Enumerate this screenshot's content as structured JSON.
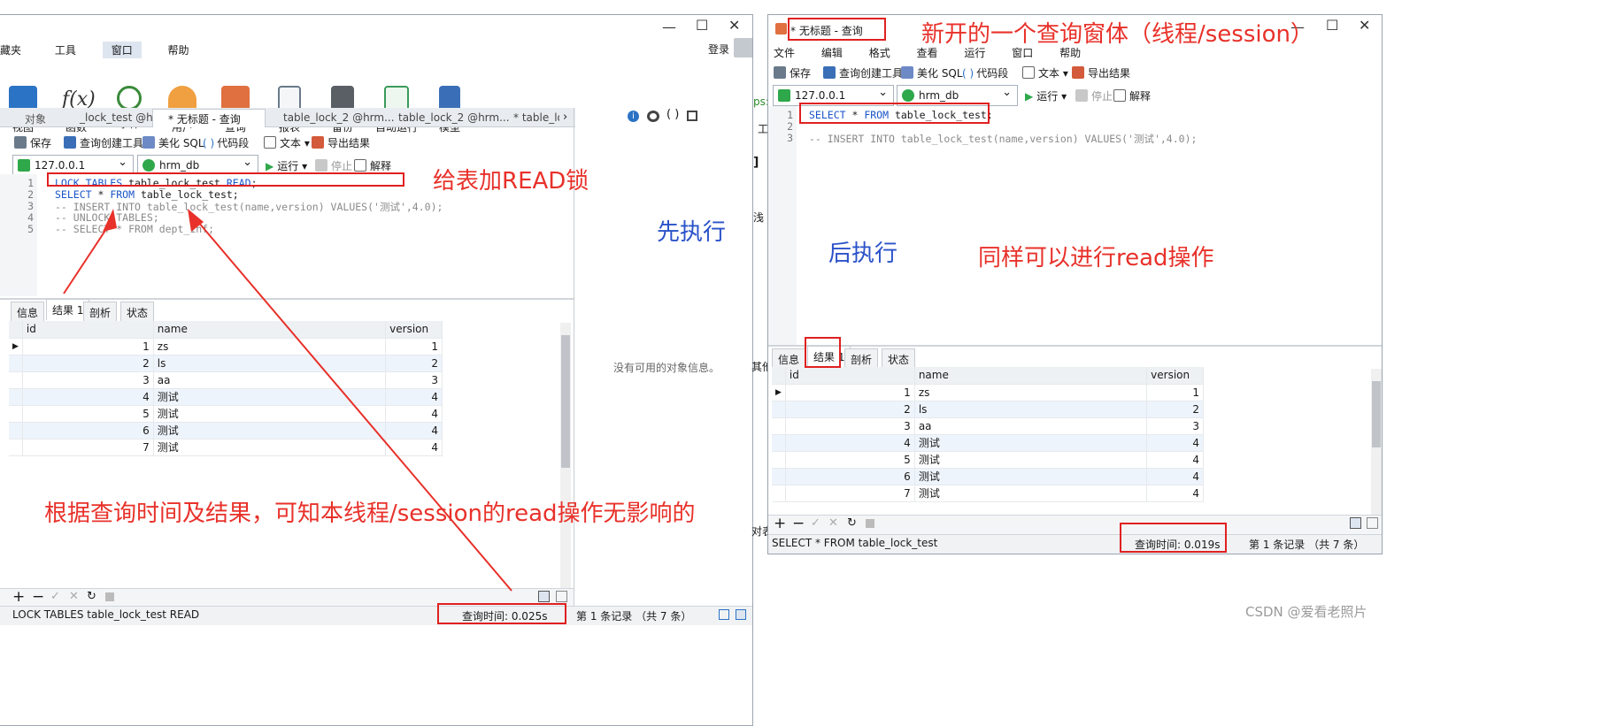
{
  "colors": {
    "annotation_red": "#e8312a",
    "annotation_blue": "#2a52c9",
    "keyword_blue": "#1a55c9"
  },
  "left_window": {
    "menu": [
      "藏夹",
      "工具",
      "窗口",
      "帮助"
    ],
    "login": "登录",
    "big_tools": [
      {
        "label": "视图",
        "icon": "view-icon"
      },
      {
        "label": "函数",
        "icon": "function-icon"
      },
      {
        "label": "事件",
        "icon": "event-clock-icon"
      },
      {
        "label": "用户",
        "icon": "user-icon"
      },
      {
        "label": "查询",
        "icon": "query-icon"
      },
      {
        "label": "报表",
        "icon": "report-icon"
      },
      {
        "label": "备份",
        "icon": "backup-icon"
      },
      {
        "label": "自动运行",
        "icon": "auto-run-icon"
      },
      {
        "label": "模型",
        "icon": "model-icon"
      }
    ],
    "doc_tabs": [
      "对象",
      "_lock_test @hr...",
      "* 无标题 - 查询",
      "table_lock_2 @hrm...",
      "table_lock_2 @hrm...",
      "* table_loc"
    ],
    "toolbar": {
      "save": "保存",
      "query_builder": "查询创建工具",
      "beautify": "美化 SQL",
      "snippet": "代码段",
      "text": "文本",
      "export": "导出结果"
    },
    "connection": "127.0.0.1",
    "database": "hrm_db",
    "run": "运行",
    "stop": "停止",
    "explain": "解释",
    "code_lines": [
      {
        "n": "1",
        "parts": [
          {
            "t": "LOCK TABLES",
            "c": "kw"
          },
          {
            "t": " table_lock_test ",
            "c": ""
          },
          {
            "t": "READ",
            "c": "kw"
          },
          {
            "t": ";",
            "c": ""
          }
        ]
      },
      {
        "n": "2",
        "parts": [
          {
            "t": "SELECT",
            "c": "kw"
          },
          {
            "t": " * ",
            "c": ""
          },
          {
            "t": "FROM",
            "c": "kw"
          },
          {
            "t": " table_lock_test;",
            "c": ""
          }
        ]
      },
      {
        "n": "3",
        "parts": [
          {
            "t": "-- INSERT INTO table_lock_test(name,version) VALUES('测试',4.0);",
            "c": "cm"
          }
        ]
      },
      {
        "n": "4",
        "parts": [
          {
            "t": "-- UNLOCK TABLES;",
            "c": "cm"
          }
        ]
      },
      {
        "n": "5",
        "parts": [
          {
            "t": "-- SELECT * FROM dept_inf;",
            "c": "cm"
          }
        ]
      }
    ],
    "result_tabs": [
      "信息",
      "结果 1",
      "剖析",
      "状态"
    ],
    "columns": [
      "id",
      "name",
      "version"
    ],
    "rows": [
      [
        "1",
        "zs",
        "1"
      ],
      [
        "2",
        "ls",
        "2"
      ],
      [
        "3",
        "aa",
        "3"
      ],
      [
        "4",
        "测试",
        "4"
      ],
      [
        "5",
        "测试",
        "4"
      ],
      [
        "6",
        "测试",
        "4"
      ],
      [
        "7",
        "测试",
        "4"
      ]
    ],
    "status_sql": "LOCK TABLES table_lock_test READ",
    "query_time": "查询时间: 0.025s",
    "record_info": "第 1 条记录 （共 7 条）",
    "no_object_info": "没有可用的对象信息。"
  },
  "right_window": {
    "title": "* 无标题 - 查询",
    "menu": [
      "文件",
      "编辑",
      "格式",
      "查看",
      "运行",
      "窗口",
      "帮助"
    ],
    "toolbar": {
      "save": "保存",
      "query_builder": "查询创建工具",
      "beautify": "美化 SQL",
      "snippet": "代码段",
      "text": "文本",
      "export": "导出结果"
    },
    "connection": "127.0.0.1",
    "database": "hrm_db",
    "run": "运行",
    "stop": "停止",
    "explain": "解释",
    "code_lines": [
      {
        "n": "1",
        "parts": [
          {
            "t": "SELECT",
            "c": "kw"
          },
          {
            "t": " * ",
            "c": ""
          },
          {
            "t": "FROM",
            "c": "kw"
          },
          {
            "t": " table_lock_test;",
            "c": ""
          }
        ]
      },
      {
        "n": "2",
        "parts": [
          {
            "t": "",
            "c": ""
          }
        ]
      },
      {
        "n": "3",
        "parts": [
          {
            "t": "-- INSERT INTO table_lock_test(name,version) VALUES('测试',4.0);",
            "c": "cm"
          }
        ]
      }
    ],
    "result_tabs": [
      "信息",
      "结果 1",
      "剖析",
      "状态"
    ],
    "columns": [
      "id",
      "name",
      "version"
    ],
    "rows": [
      [
        "1",
        "zs",
        "1"
      ],
      [
        "2",
        "ls",
        "2"
      ],
      [
        "3",
        "aa",
        "3"
      ],
      [
        "4",
        "测试",
        "4"
      ],
      [
        "5",
        "测试",
        "4"
      ],
      [
        "6",
        "测试",
        "4"
      ],
      [
        "7",
        "测试",
        "4"
      ]
    ],
    "status_sql": "SELECT * FROM table_lock_test",
    "query_time": "查询时间: 0.019s",
    "record_info": "第 1 条记录 （共 7 条）"
  },
  "annotations": {
    "new_window": "新开的一个查询窗体（线程/session）",
    "add_read_lock": "给表加READ锁",
    "first_exec": "先执行",
    "later_exec": "后执行",
    "same_read": "同样可以进行read操作",
    "conclusion": "根据查询时间及结果，可知本线程/session的read操作无影响的"
  },
  "background_fragments": {
    "frag1": "ps:",
    "frag2": "工",
    "frag3": "]",
    "frag4": "浅",
    "frag5": "其他",
    "frag6": "对表"
  },
  "watermark": "CSDN @爱看老照片"
}
